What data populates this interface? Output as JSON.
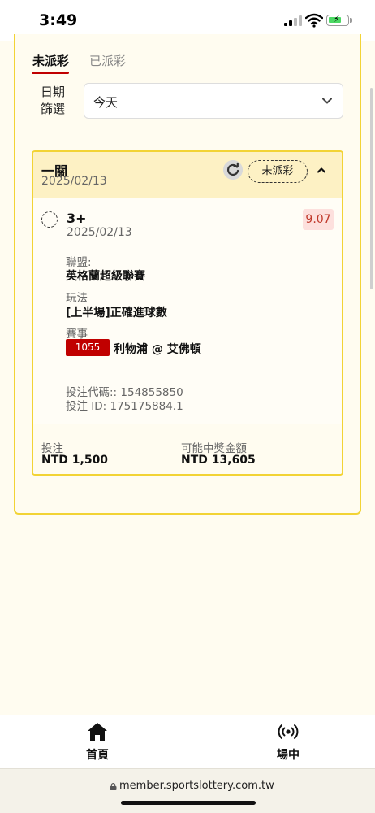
{
  "status_bar": {
    "time": "3:49"
  },
  "tabs": [
    {
      "label": "未派彩",
      "active": true
    },
    {
      "label": "已派彩",
      "active": false
    }
  ],
  "filter": {
    "label": "日期篩選",
    "value": "今天"
  },
  "bet": {
    "type": "一關",
    "date": "2025/02/13",
    "status": "未派彩",
    "selection": "3+",
    "selection_date": "2025/02/13",
    "odds": "9.07",
    "league_label": "聯盟:",
    "league": "英格蘭超級聯賽",
    "market_label": "玩法",
    "market": "[上半場]正確進球數",
    "event_label": "賽事",
    "match_code": "1055",
    "match_name": "利物浦 @ 艾佛頓",
    "bet_code": "投注代碼:: 154855850",
    "bet_id": "投注 ID: 175175884.1",
    "stake_label": "投注",
    "stake_value": "NTD 1,500",
    "payout_label": "可能中獎金額",
    "payout_value": "NTD 13,605"
  },
  "nav": [
    {
      "label": "首頁",
      "icon": "home-icon"
    },
    {
      "label": "場中",
      "icon": "live-broadcast-icon"
    }
  ],
  "url_bar": {
    "url": "member.sportslottery.com.tw"
  },
  "colors": {
    "accent": "#c00000",
    "border": "#f2d335",
    "header_bg": "#fdf1c4",
    "odds": "#c0392b"
  }
}
